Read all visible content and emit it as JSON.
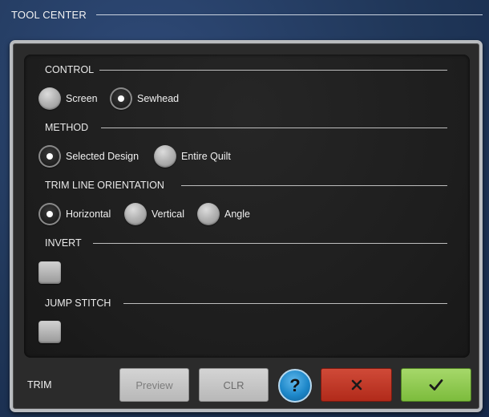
{
  "window": {
    "title": "TOOL CENTER"
  },
  "sections": {
    "control": {
      "label": "CONTROL",
      "options": [
        {
          "label": "Screen",
          "selected": false
        },
        {
          "label": "Sewhead",
          "selected": true
        }
      ]
    },
    "method": {
      "label": "METHOD",
      "options": [
        {
          "label": "Selected Design",
          "selected": true
        },
        {
          "label": "Entire Quilt",
          "selected": false
        }
      ]
    },
    "orientation": {
      "label": "TRIM LINE ORIENTATION",
      "options": [
        {
          "label": "Horizontal",
          "selected": true
        },
        {
          "label": "Vertical",
          "selected": false
        },
        {
          "label": "Angle",
          "selected": false
        }
      ]
    },
    "invert": {
      "label": "INVERT",
      "checked": false
    },
    "jump_stitch": {
      "label": "JUMP STITCH",
      "checked": false
    }
  },
  "footer": {
    "label": "TRIM",
    "preview_label": "Preview",
    "clr_label": "CLR",
    "help_label": "?",
    "cancel_icon": "x-icon",
    "ok_icon": "checkmark-icon"
  },
  "colors": {
    "cancel": "#c03a28",
    "ok": "#8cc84b",
    "help": "#1d87c9"
  }
}
